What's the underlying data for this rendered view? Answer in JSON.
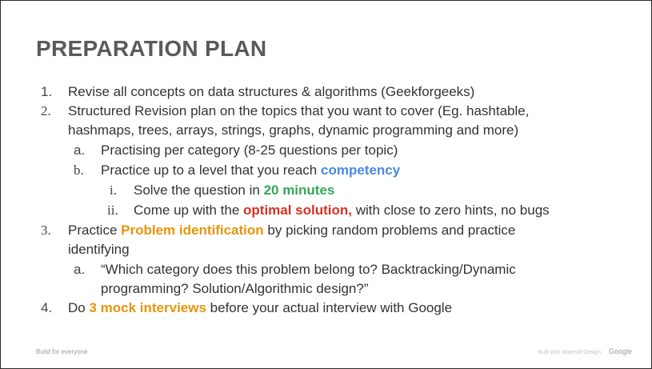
{
  "slide": {
    "title": "PREPARATION PLAN",
    "colors": {
      "blue": "#4a86e8",
      "green": "#34a853",
      "red": "#d93025",
      "orange": "#e8940b"
    },
    "items": [
      {
        "marker": "1.",
        "text": "Revise all concepts on data structures & algorithms (Geekforgeeks)"
      },
      {
        "marker": "2.",
        "text_line1": "Structured Revision plan on the topics that you want to cover (Eg. hashtable,",
        "text_line2": "hashmaps, trees, arrays, strings, graphs, dynamic programming and more)"
      },
      {
        "marker": "a.",
        "text": "Practising per category (8-25 questions per topic)"
      },
      {
        "marker": "b.",
        "before": "Practice up to a level that you reach ",
        "highlight": "competency"
      },
      {
        "marker": "i.",
        "before": "Solve the question in ",
        "highlight": "20 minutes"
      },
      {
        "marker": "ii.",
        "before": "Come up with the ",
        "highlight": "optimal solution,",
        "after": " with close to zero hints, no bugs"
      },
      {
        "marker": "3.",
        "before": "Practice ",
        "highlight": "Problem identification",
        "after": " by picking random problems and practice",
        "text_line2": "identifying"
      },
      {
        "marker": "a.",
        "text_line1": "“Which category does this problem belong to? Backtracking/Dynamic",
        "text_line2": "programming? Solution/Algorithmic design?”"
      },
      {
        "marker": "4.",
        "before": "Do ",
        "highlight": "3 mock interviews",
        "after": " before your actual interview with Google"
      }
    ],
    "footer": {
      "left": "Build for everyone",
      "right_small": "Built with Material Design",
      "logo": "Google"
    }
  }
}
